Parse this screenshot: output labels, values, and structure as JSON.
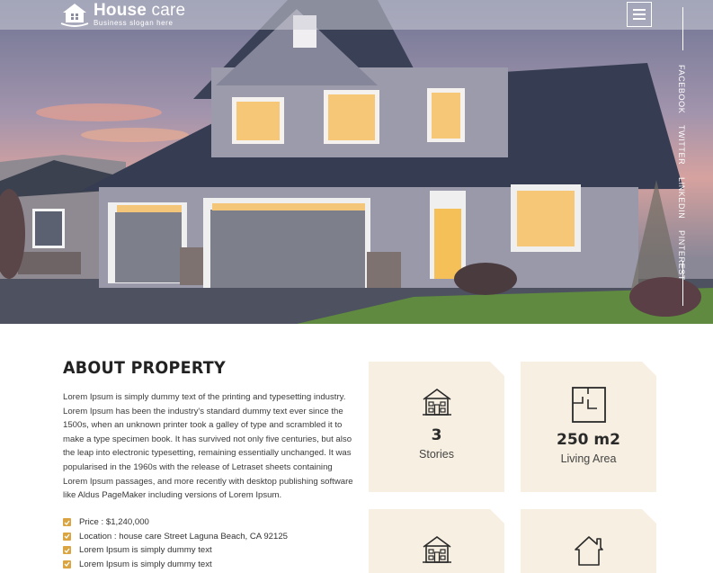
{
  "header": {
    "logo_title_bold": "House",
    "logo_title_light": " care",
    "logo_slogan": "Business slogan here",
    "menu_icon": "hamburger-icon"
  },
  "social": [
    "FACEBOOK",
    "TWITTER",
    "LINKEDIN",
    "PINTEREST"
  ],
  "about": {
    "title": "ABOUT PROPERTY",
    "body": "Lorem Ipsum is simply dummy text of the printing and typesetting industry. Lorem Ipsum has been the industry's standard dummy text ever since the 1500s, when an unknown printer took a galley of type and scrambled it to make a type specimen book. It has survived not only five centuries, but also the leap into electronic typesetting, remaining essentially unchanged. It was popularised in the 1960s with the release of Letraset sheets containing Lorem Ipsum passages, and more recently with desktop publishing software like Aldus PageMaker including versions of Lorem Ipsum.",
    "features": [
      "Price : $1,240,000",
      "Location : house care Street Laguna Beach, CA 92125",
      "Lorem Ipsum is simply dummy text",
      "Lorem Ipsum is simply dummy text"
    ]
  },
  "cards": [
    {
      "value": "3",
      "label": "Stories",
      "icon": "house-icon"
    },
    {
      "value": "250 m2",
      "label": "Living Area",
      "icon": "floorplan-icon"
    },
    {
      "icon": "house-icon"
    },
    {
      "icon": "home-outline-icon"
    }
  ],
  "colors": {
    "accent": "#d9a441",
    "card_bg": "#f7efe1"
  }
}
